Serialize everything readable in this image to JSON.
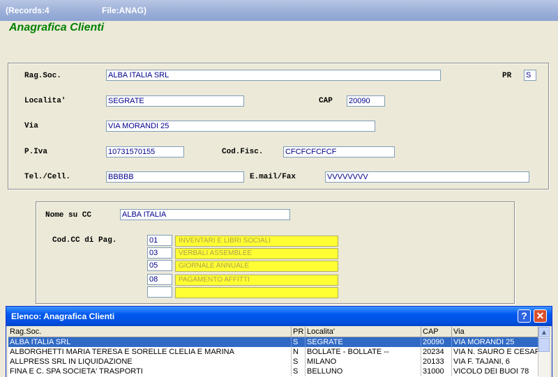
{
  "window": {
    "records": "(Records:4",
    "file": "File:ANAG)"
  },
  "form_title": "Anagrafica Clienti",
  "fields": {
    "rag_soc": {
      "label": "Rag.Soc.",
      "value": "ALBA ITALIA SRL"
    },
    "pr": {
      "label": "PR",
      "value": "S"
    },
    "localita": {
      "label": "Localita'",
      "value": "SEGRATE"
    },
    "cap": {
      "label": "CAP",
      "value": "20090"
    },
    "via": {
      "label": "Via",
      "value": "VIA MORANDI 25"
    },
    "piva": {
      "label": "P.Iva",
      "value": "10731570155"
    },
    "cod_fisc": {
      "label": "Cod.Fisc.",
      "value": "CFCFCFCFCF"
    },
    "tel": {
      "label": "Tel./Cell.",
      "value": "BBBBB"
    },
    "email": {
      "label": "E.mail/Fax",
      "value": "VVVVVVVV"
    }
  },
  "cc": {
    "nome_label": "Nome su CC",
    "nome_value": "ALBA ITALIA",
    "cod_label": "Cod.CC di Pag.",
    "codes": [
      {
        "code": "01",
        "desc": "INVENTARI E LIBRI SOCIALI"
      },
      {
        "code": "03",
        "desc": "VERBALI ASSEMBLEE"
      },
      {
        "code": "05",
        "desc": "GIORNALE ANNUALE"
      },
      {
        "code": "08",
        "desc": "PAGAMENTO AFFITTI"
      },
      {
        "code": "",
        "desc": ""
      }
    ]
  },
  "list_dialog": {
    "title": "Elenco: Anagrafica Clienti",
    "help_label": "?",
    "close_label": "✕",
    "columns": [
      "Rag.Soc.",
      "PR",
      "Localita'",
      "CAP",
      "Via"
    ],
    "rows": [
      [
        "ALBA ITALIA SRL",
        "S",
        "SEGRATE",
        "20090",
        "VIA MORANDI 25"
      ],
      [
        "ALBORGHETTI MARIA TERESA E SORELLE CLELIA E MARINA",
        "N",
        "BOLLATE - BOLLATE --",
        "20234",
        "VIA N. SAURO E CESAP"
      ],
      [
        "ALLPRESS SRL IN LIQUIDAZIONE",
        "S",
        "MILANO",
        "20133",
        "VIA F. TAJANI, 6"
      ],
      [
        "FINA E C. SPA SOCIETA' TRASPORTI",
        "S",
        "BELLUNO",
        "31000",
        "VICOLO DEI BUOI 78"
      ]
    ],
    "scroll_up": "▲"
  }
}
